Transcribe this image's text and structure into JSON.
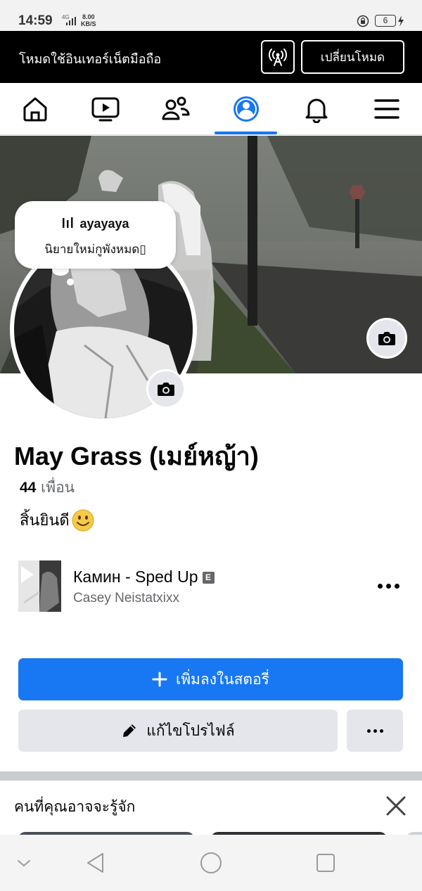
{
  "status_bar": {
    "time": "14:59",
    "network": "4G",
    "speed_value": "8.00",
    "speed_unit": "KB/S",
    "battery": "6"
  },
  "data_banner": {
    "text": "โหมดใช้อินเทอร์เน็ตมือถือ",
    "switch_label": "เปลี่ยนโหมด"
  },
  "top_nav": {
    "items": [
      "home-icon",
      "video-icon",
      "friends-icon",
      "profile-icon",
      "bell-icon",
      "menu-icon"
    ],
    "active": "profile-icon",
    "accent": "#1877f2"
  },
  "note": {
    "song": "ayayaya",
    "text": "นิยายใหม่กูพังหมด▯"
  },
  "profile": {
    "name": "May Grass (เมย์หญ้า)",
    "friend_count": "44",
    "friend_label": "เพื่อน",
    "bio": "สิ้นยินดี"
  },
  "music": {
    "title": "Камин - Sped Up",
    "explicit_badge": "E",
    "artist": "Casey Neistatxixx"
  },
  "buttons": {
    "add_story": "เพิ่มลงในสตอรี่",
    "edit_profile": "แก้ไขโปรไฟล์"
  },
  "pymk": {
    "title": "คนที่คุณอาจจะรู้จัก"
  },
  "colors": {
    "primary_blue": "#1877f2",
    "button_gray": "#e4e6eb",
    "secondary_text": "#65676b"
  }
}
